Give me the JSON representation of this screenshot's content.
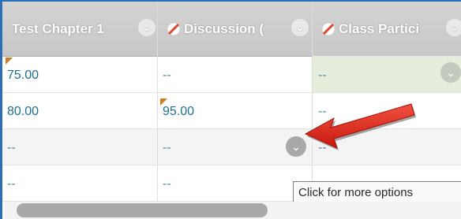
{
  "columns": [
    {
      "label": "Test Chapter 1",
      "icon": "chevron-down-icon"
    },
    {
      "label": "Discussion (",
      "icon": "not-counted-icon"
    },
    {
      "label": "Class Partici",
      "icon": "not-counted-icon"
    }
  ],
  "rows": [
    [
      "75.00",
      "--",
      "--"
    ],
    [
      "80.00",
      "95.00",
      "--"
    ],
    [
      "--",
      "--",
      "--"
    ],
    [
      "--",
      "--",
      ""
    ]
  ],
  "tooltip": "Click for more options",
  "colors": {
    "frame": "#2c6fb6",
    "header_bg": "#cccccc",
    "value_text": "#1c6f8f",
    "needs_grading_flag": "#d07c1f",
    "arrow": "#e0251b"
  }
}
